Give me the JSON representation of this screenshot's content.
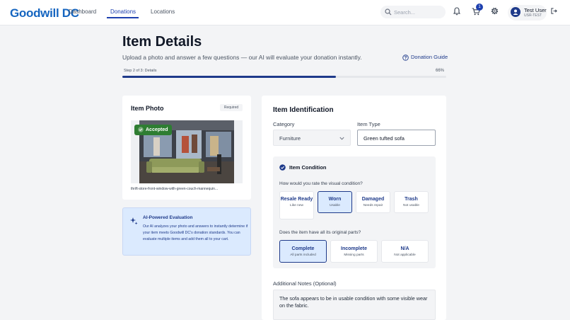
{
  "header": {
    "logo": "Goodwill DC",
    "nav": [
      {
        "label": "Dashboard",
        "active": false
      },
      {
        "label": "Donations",
        "active": true
      },
      {
        "label": "Locations",
        "active": false
      }
    ],
    "search_placeholder": "Search...",
    "cart_count": "1",
    "user_name": "Test User",
    "user_id": "USR-TEST",
    "icons": [
      "search-icon",
      "bell-icon",
      "cart-icon",
      "gear-icon",
      "user-icon",
      "logout-icon"
    ]
  },
  "page": {
    "title": "Item Details",
    "subtitle": "Upload a photo and answer a few questions — our AI will evaluate your donation instantly.",
    "guide_link": "Donation Guide",
    "step_text": "Step 2 of 3: Details",
    "progress_pct": "66%",
    "progress_value": 0.66,
    "accent_color": "#1e3a8a",
    "success_color": "#2e7d32"
  },
  "photo_card": {
    "title": "Item Photo",
    "required": "Required",
    "status": "Accepted",
    "filename": "thrift-store-front-window-with-green-couch-mannequin..."
  },
  "ai_card": {
    "title": "AI-Powered Evaluation",
    "body": "Our AI analyzes your photo and answers to instantly determine if your item meets Goodwill DC's donation standards. You can evaluate multiple items and add them all to your cart."
  },
  "identification": {
    "title": "Item Identification",
    "category_label": "Category",
    "category_value": "Furniture",
    "type_label": "Item Type",
    "type_value": "Green tufted sofa"
  },
  "condition": {
    "title": "Item Condition",
    "q1": "How would you rate the visual condition?",
    "q1_options": [
      {
        "label": "Resale Ready",
        "sub": "Like new",
        "selected": false
      },
      {
        "label": "Worn",
        "sub": "Usable",
        "selected": true
      },
      {
        "label": "Damaged",
        "sub": "Needs repair",
        "selected": false
      },
      {
        "label": "Trash",
        "sub": "Not usable",
        "selected": false
      }
    ],
    "q2": "Does the item have all its original parts?",
    "q2_options": [
      {
        "label": "Complete",
        "sub": "All parts included",
        "selected": true
      },
      {
        "label": "Incomplete",
        "sub": "Missing parts",
        "selected": false
      },
      {
        "label": "N/A",
        "sub": "Not applicable",
        "selected": false
      }
    ]
  },
  "notes": {
    "label": "Additional Notes (Optional)",
    "value": "The sofa appears to be in usable condition with some visible wear on the fabric."
  }
}
